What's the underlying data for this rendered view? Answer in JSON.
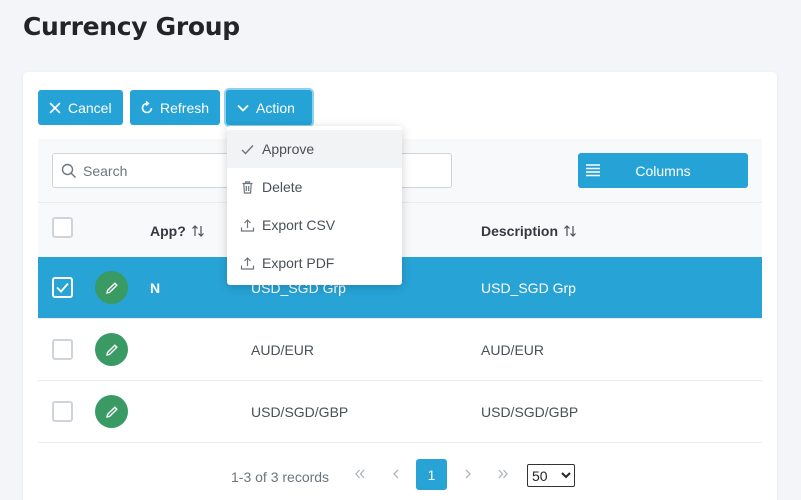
{
  "page": {
    "title": "Currency Group"
  },
  "toolbar": {
    "cancel_label": "Cancel",
    "refresh_label": "Refresh",
    "action_label": "Action"
  },
  "action_menu": {
    "items": [
      {
        "label": "Approve",
        "icon": "check-icon"
      },
      {
        "label": "Delete",
        "icon": "trash-icon"
      },
      {
        "label": "Export CSV",
        "icon": "upload-icon"
      },
      {
        "label": "Export PDF",
        "icon": "upload-icon"
      }
    ]
  },
  "search": {
    "placeholder": "Search",
    "value": ""
  },
  "columns_button": {
    "label": "Columns"
  },
  "table": {
    "headers": {
      "approved": "App?",
      "description": "Description"
    },
    "rows": [
      {
        "approved": "N",
        "code": "USD_SGD Grp",
        "description": "USD_SGD Grp",
        "selected": true
      },
      {
        "approved": "",
        "code": "AUD/EUR",
        "description": "AUD/EUR",
        "selected": false
      },
      {
        "approved": "",
        "code": "USD/SGD/GBP",
        "description": "USD/SGD/GBP",
        "selected": false
      }
    ]
  },
  "pagination": {
    "info": "1-3 of 3 records",
    "current_page": "1",
    "rows_per_page": "50",
    "rows_per_page_options": [
      "50"
    ]
  },
  "colors": {
    "accent": "#27a3d6",
    "edit_button": "#3a9a64"
  }
}
